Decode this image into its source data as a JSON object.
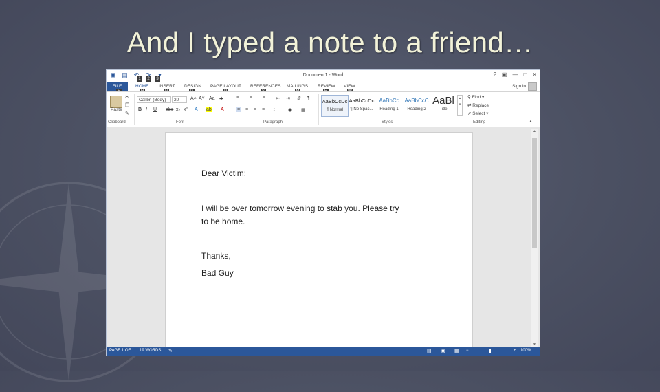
{
  "slide": {
    "title": "And I typed a note to a friend…"
  },
  "colors": {
    "word_blue": "#2b579a",
    "background": "#4c5163",
    "title_text": "#f2f2d8"
  },
  "word": {
    "window_title": "Document1 - Word",
    "window_controls": {
      "help": "?",
      "ribbon_display": "▣",
      "minimize": "—",
      "restore": "□",
      "close": "✕"
    },
    "qat_keytips": [
      "1",
      "2",
      "3"
    ],
    "tabs": [
      {
        "label": "FILE",
        "keytip": "F"
      },
      {
        "label": "HOME",
        "keytip": "H"
      },
      {
        "label": "INSERT",
        "keytip": "N"
      },
      {
        "label": "DESIGN",
        "keytip": "G"
      },
      {
        "label": "PAGE LAYOUT",
        "keytip": "P"
      },
      {
        "label": "REFERENCES",
        "keytip": "S"
      },
      {
        "label": "MAILINGS",
        "keytip": "M"
      },
      {
        "label": "REVIEW",
        "keytip": "R"
      },
      {
        "label": "VIEW",
        "keytip": "W"
      }
    ],
    "sign_in": "Sign in",
    "ribbon": {
      "clipboard": {
        "paste": "Paste",
        "group_label": "Clipboard"
      },
      "font": {
        "font_name": "Calibri (Body)",
        "font_size": "20",
        "group_label": "Font",
        "case": "Aa"
      },
      "paragraph": {
        "group_label": "Paragraph",
        "pilcrow": "¶"
      },
      "styles": {
        "group_label": "Styles",
        "items": [
          {
            "sample": "AaBbCcDc",
            "label": "¶ Normal"
          },
          {
            "sample": "AaBbCcDc",
            "label": "¶ No Spac..."
          },
          {
            "sample": "AaBbCc",
            "label": "Heading 1"
          },
          {
            "sample": "AaBbCcC",
            "label": "Heading 2"
          },
          {
            "sample": "AaBl",
            "label": "Title"
          }
        ]
      },
      "editing": {
        "group_label": "Editing",
        "find": "Find",
        "replace": "Replace",
        "select": "Select"
      }
    },
    "document": {
      "lines": [
        "Dear Victim:",
        "I will be over tomorrow evening to stab you.  Please try",
        "to be home.",
        "Thanks,",
        "Bad Guy"
      ]
    },
    "status": {
      "page": "PAGE 1 OF 1",
      "words": "19 WORDS",
      "zoom_minus": "−",
      "zoom_plus": "+",
      "zoom": "100%"
    }
  }
}
